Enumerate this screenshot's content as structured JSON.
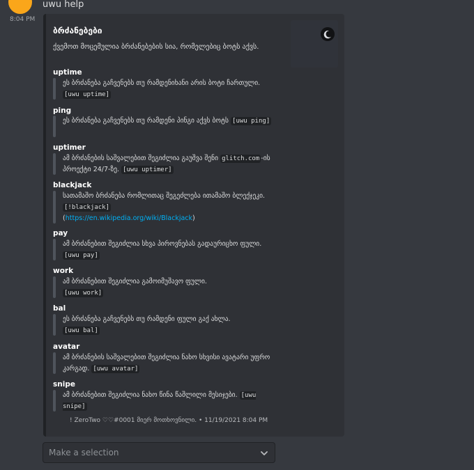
{
  "top_message": "uwu help",
  "timestamp": "8:04 PM",
  "embed": {
    "title": "ბრძანებები",
    "description": "ქვემოთ მოცემულია ბრძანებების სია, რომელებიც ბოტს აქვს.",
    "fields": [
      {
        "name": "uptime",
        "text_before": "ეს ბრძანება გაჩვენებს თუ რამდენიხანი არის ბოტი ჩართული. ",
        "code": "[uwu uptime]"
      },
      {
        "name": "ping",
        "text_before": "ეს ბრძანება გაჩვენებს თუ რამდენი პინგი აქვს ბოტს ",
        "code": "[uwu ping]"
      },
      {
        "name": "uptimer",
        "text_before": "ამ ბრძანების საშვალებით შეგიძლია გაუშვა შენი ",
        "code_inline": "glitch.com",
        "text_after": "-ის პროექტი 24/7-ზე. ",
        "code": "[uwu uptimer]"
      },
      {
        "name": "blackjack",
        "text_before": "სათამაშო ბრძანება რომლითაც შეგეძლება ითამაშო ბლექჯეკი. ",
        "code": "[!blackjack]",
        "link": "https://en.wikipedia.org/wiki/Blackjack"
      },
      {
        "name": "pay",
        "text_before": "ამ ბრძანებით შეგიძლია სხვა პიროვნებას გადაურიცხო ფული. ",
        "code": "[uwu pay]"
      },
      {
        "name": "work",
        "text_before": "ამ ბრძანებით შეგიძლია გამოიმუშავო ფული. ",
        "code": "[uwu work]"
      },
      {
        "name": "bal",
        "text_before": "ეს ბრძანება გაჩვენებს თუ რამდენი ფული გაქ ახლა. ",
        "code": "[uwu bal]"
      },
      {
        "name": "avatar",
        "text_before": "ამ ბრძანების საშვალებით შეგიძლია ნახო სხვისი ავატარი უფრო კარგად. ",
        "code": "[uwu avatar]"
      },
      {
        "name": "snipe",
        "text_before": "ამ ბრძანებით შეგიძლია ნახო წინა წაშლილი მესიჯები. ",
        "code": "[uwu snipe]"
      }
    ],
    "footer": "! ZeroTwo ♡♡#0001 მიერ მოთხოვნილი. • 11/19/2021 8:04 PM"
  },
  "select": {
    "placeholder": "Make a selection"
  },
  "icons": {
    "thumbnail": "moon-icon",
    "chevron": "chevron-down-icon"
  },
  "colors": {
    "background": "#36393f",
    "embed_background": "#2f3136",
    "link": "#00b0f4",
    "avatar": "#faa61a"
  }
}
